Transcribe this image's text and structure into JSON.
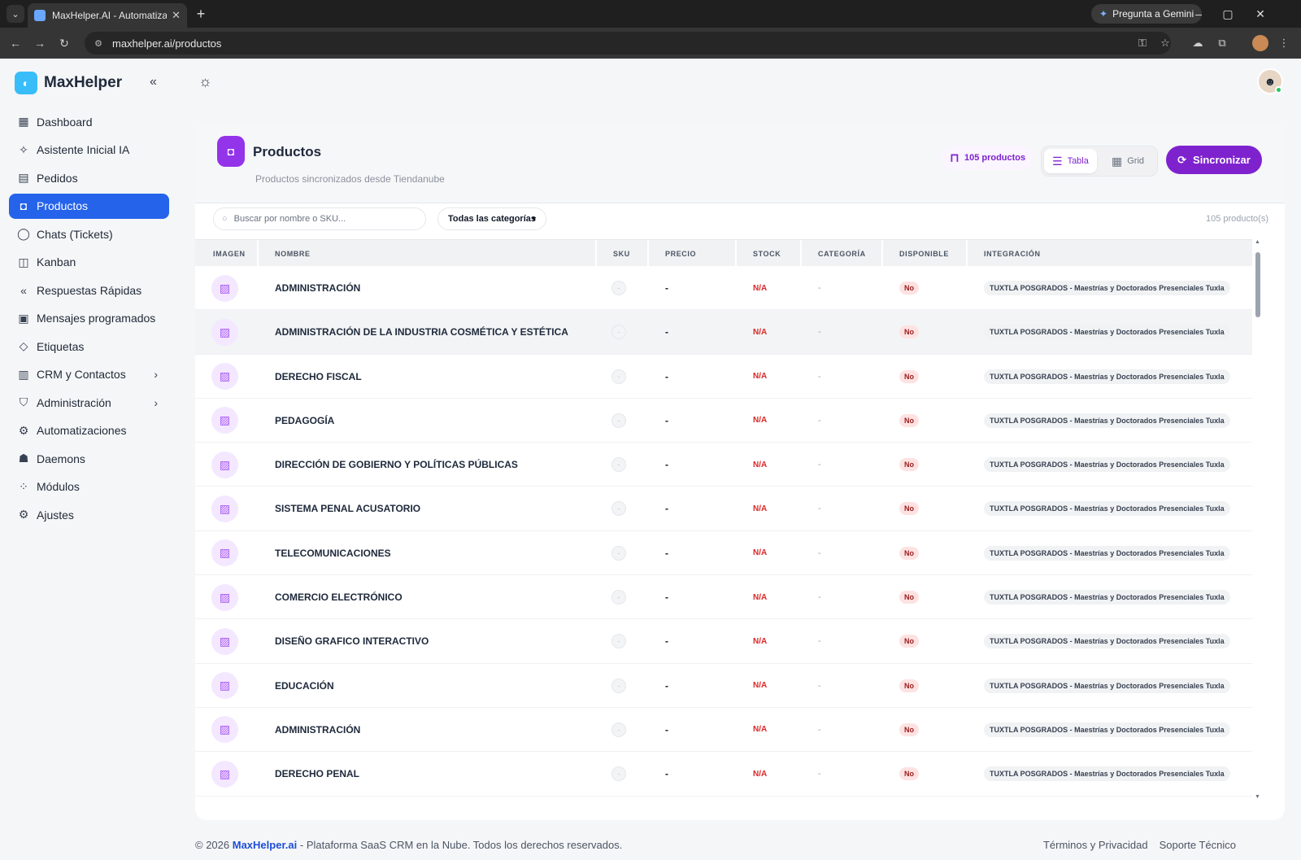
{
  "browser": {
    "tab_title": "MaxHelper.AI - Automatiza tu a",
    "url": "maxhelper.ai/productos",
    "gemini_label": "Pregunta a Gemini"
  },
  "sidebar": {
    "brand": "MaxHelper",
    "items": [
      {
        "label": "Dashboard",
        "icon": "dashboard-icon",
        "glyph": "▦"
      },
      {
        "label": "Asistente Inicial IA",
        "icon": "sparkle-icon",
        "glyph": "✧"
      },
      {
        "label": "Pedidos",
        "icon": "receipt-icon",
        "glyph": "▤"
      },
      {
        "label": "Productos",
        "icon": "shopping-bag-icon",
        "glyph": "◘",
        "active": true
      },
      {
        "label": "Chats (Tickets)",
        "icon": "whatsapp-icon",
        "glyph": "◯"
      },
      {
        "label": "Kanban",
        "icon": "columns-icon",
        "glyph": "◫"
      },
      {
        "label": "Respuestas Rápidas",
        "icon": "reply-all-icon",
        "glyph": "«"
      },
      {
        "label": "Mensajes programados",
        "icon": "calendar-icon",
        "glyph": "▣"
      },
      {
        "label": "Etiquetas",
        "icon": "tag-icon",
        "glyph": "◇"
      },
      {
        "label": "CRM y Contactos",
        "icon": "contacts-icon",
        "glyph": "▥",
        "submenu": true
      },
      {
        "label": "Administración",
        "icon": "shield-icon",
        "glyph": "⛉",
        "submenu": true
      },
      {
        "label": "Automatizaciones",
        "icon": "robot-icon",
        "glyph": "⚙"
      },
      {
        "label": "Daemons",
        "icon": "daemon-icon",
        "glyph": "☗"
      },
      {
        "label": "Módulos",
        "icon": "modules-icon",
        "glyph": "⁘"
      },
      {
        "label": "Ajustes",
        "icon": "gear-icon",
        "glyph": "⚙"
      }
    ]
  },
  "header": {
    "title": "Productos",
    "subtitle": "Productos sincronizados desde Tiendanube",
    "count_badge": "105 productos",
    "view_table": "Tabla",
    "view_grid": "Grid",
    "sync_label": "Sincronizar"
  },
  "filters": {
    "search_placeholder": "Buscar por nombre o SKU...",
    "category_value": "Todas las categorías",
    "result_count": "105 producto(s)"
  },
  "table": {
    "columns": [
      "IMAGEN",
      "NOMBRE",
      "SKU",
      "PRECIO",
      "STOCK",
      "CATEGORÍA",
      "DISPONIBLE",
      "INTEGRACIÓN"
    ],
    "rows": [
      {
        "name": "ADMINISTRACIÓN",
        "sku": "-",
        "price": "-",
        "stock": "N/A",
        "category": "-",
        "available": "No",
        "integration": "TUXTLA POSGRADOS - Maestrías y Doctorados Presenciales Tuxla"
      },
      {
        "name": "ADMINISTRACIÓN DE LA INDUSTRIA COSMÉTICA Y ESTÉTICA",
        "sku": "-",
        "price": "-",
        "stock": "N/A",
        "category": "-",
        "available": "No",
        "integration": "TUXTLA POSGRADOS - Maestrías y Doctorados Presenciales Tuxla"
      },
      {
        "name": "DERECHO FISCAL",
        "sku": "-",
        "price": "-",
        "stock": "N/A",
        "category": "-",
        "available": "No",
        "integration": "TUXTLA POSGRADOS - Maestrías y Doctorados Presenciales Tuxla"
      },
      {
        "name": "PEDAGOGÍA",
        "sku": "-",
        "price": "-",
        "stock": "N/A",
        "category": "-",
        "available": "No",
        "integration": "TUXTLA POSGRADOS - Maestrías y Doctorados Presenciales Tuxla"
      },
      {
        "name": "DIRECCIÓN DE GOBIERNO Y POLÍTICAS PÚBLICAS",
        "sku": "-",
        "price": "-",
        "stock": "N/A",
        "category": "-",
        "available": "No",
        "integration": "TUXTLA POSGRADOS - Maestrías y Doctorados Presenciales Tuxla"
      },
      {
        "name": "SISTEMA PENAL ACUSATORIO",
        "sku": "-",
        "price": "-",
        "stock": "N/A",
        "category": "-",
        "available": "No",
        "integration": "TUXTLA POSGRADOS - Maestrías y Doctorados Presenciales Tuxla"
      },
      {
        "name": "TELECOMUNICACIONES",
        "sku": "-",
        "price": "-",
        "stock": "N/A",
        "category": "-",
        "available": "No",
        "integration": "TUXTLA POSGRADOS - Maestrías y Doctorados Presenciales Tuxla"
      },
      {
        "name": "COMERCIO ELECTRÓNICO",
        "sku": "-",
        "price": "-",
        "stock": "N/A",
        "category": "-",
        "available": "No",
        "integration": "TUXTLA POSGRADOS - Maestrías y Doctorados Presenciales Tuxla"
      },
      {
        "name": "DISEÑO GRAFICO INTERACTIVO",
        "sku": "-",
        "price": "-",
        "stock": "N/A",
        "category": "-",
        "available": "No",
        "integration": "TUXTLA POSGRADOS - Maestrías y Doctorados Presenciales Tuxla"
      },
      {
        "name": "EDUCACIÓN",
        "sku": "-",
        "price": "-",
        "stock": "N/A",
        "category": "-",
        "available": "No",
        "integration": "TUXTLA POSGRADOS - Maestrías y Doctorados Presenciales Tuxla"
      },
      {
        "name": "ADMINISTRACIÓN",
        "sku": "-",
        "price": "-",
        "stock": "N/A",
        "category": "-",
        "available": "No",
        "integration": "TUXTLA POSGRADOS - Maestrías y Doctorados Presenciales Tuxla"
      },
      {
        "name": "DERECHO PENAL",
        "sku": "-",
        "price": "-",
        "stock": "N/A",
        "category": "-",
        "available": "No",
        "integration": "TUXTLA POSGRADOS - Maestrías y Doctorados Presenciales Tuxla"
      }
    ]
  },
  "footer": {
    "copyright": "© 2026",
    "brand": "MaxHelper.ai",
    "tagline": "- Plataforma SaaS CRM en la Nube. Todos los derechos reservados.",
    "terms": "Términos y Privacidad",
    "support": "Soporte Técnico"
  },
  "colors": {
    "accent_blue": "#2563eb",
    "accent_purple": "#7e22ce",
    "danger": "#dc2626"
  }
}
